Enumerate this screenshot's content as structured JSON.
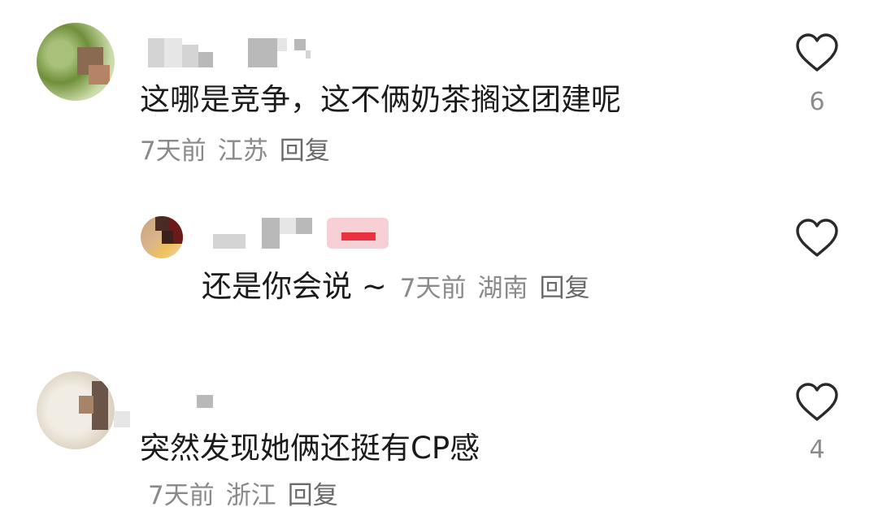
{
  "comments": [
    {
      "text": "这哪是竞争，这不俩奶茶搁这团建呢",
      "time": "7天前",
      "location": "江苏",
      "reply_label": "回复",
      "like_count": "6"
    },
    {
      "text": "还是你会说 ~",
      "time": "7天前",
      "location": "湖南",
      "reply_label": "回复",
      "like_count": ""
    },
    {
      "text": "突然发现她俩还挺有CP感",
      "time": "7天前",
      "location": "浙江",
      "reply_label": "回复",
      "like_count": "4"
    }
  ],
  "icons": {
    "like": "heart-outline-icon"
  },
  "colors": {
    "text": "#1b1b1b",
    "meta": "#8a8a8a",
    "icon": "#2a2a2a"
  }
}
